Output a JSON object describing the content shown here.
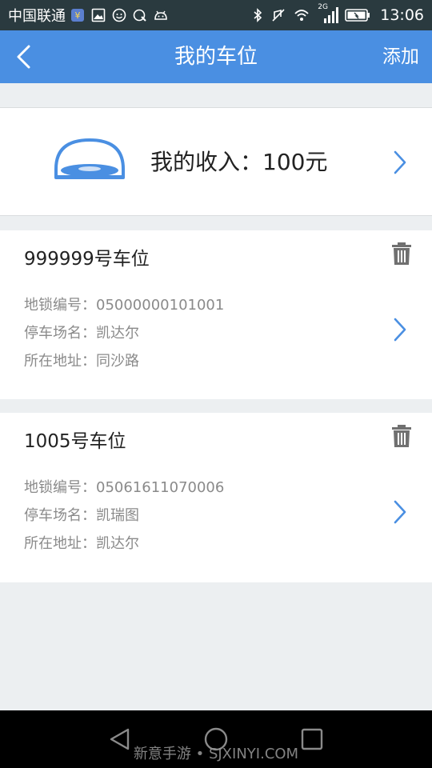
{
  "status_bar": {
    "carrier": "中国联通",
    "time": "13:06",
    "network_label": "2G",
    "left_icons": [
      "sim-badge-icon",
      "image-icon",
      "face-icon",
      "settings-shield-icon",
      "android-icon"
    ],
    "right_icons": [
      "bluetooth-icon",
      "mute-icon",
      "wifi-icon",
      "signal-icon",
      "battery-icon"
    ]
  },
  "app_bar": {
    "title": "我的车位",
    "add_label": "添加",
    "back_icon": "chevron-left-icon"
  },
  "income": {
    "label": "我的收入：100元",
    "icon": "parking-lock-icon"
  },
  "spots": [
    {
      "title": "999999号车位",
      "lock_id": "地锁编号：05000000101001",
      "lot_name": "停车场名：凯达尔",
      "address": "所在地址：同沙路"
    },
    {
      "title": "1005号车位",
      "lock_id": "地锁编号：05061611070006",
      "lot_name": "停车场名：凯瑞图",
      "address": "所在地址：凯达尔"
    }
  ],
  "nav_bar": {
    "watermark": "新意手游 • SJXINYI.COM"
  },
  "colors": {
    "primary": "#4a8fe2",
    "status_bar": "#2a3a3f",
    "background": "#eceff1",
    "secondary_text": "#8a8a8a"
  }
}
